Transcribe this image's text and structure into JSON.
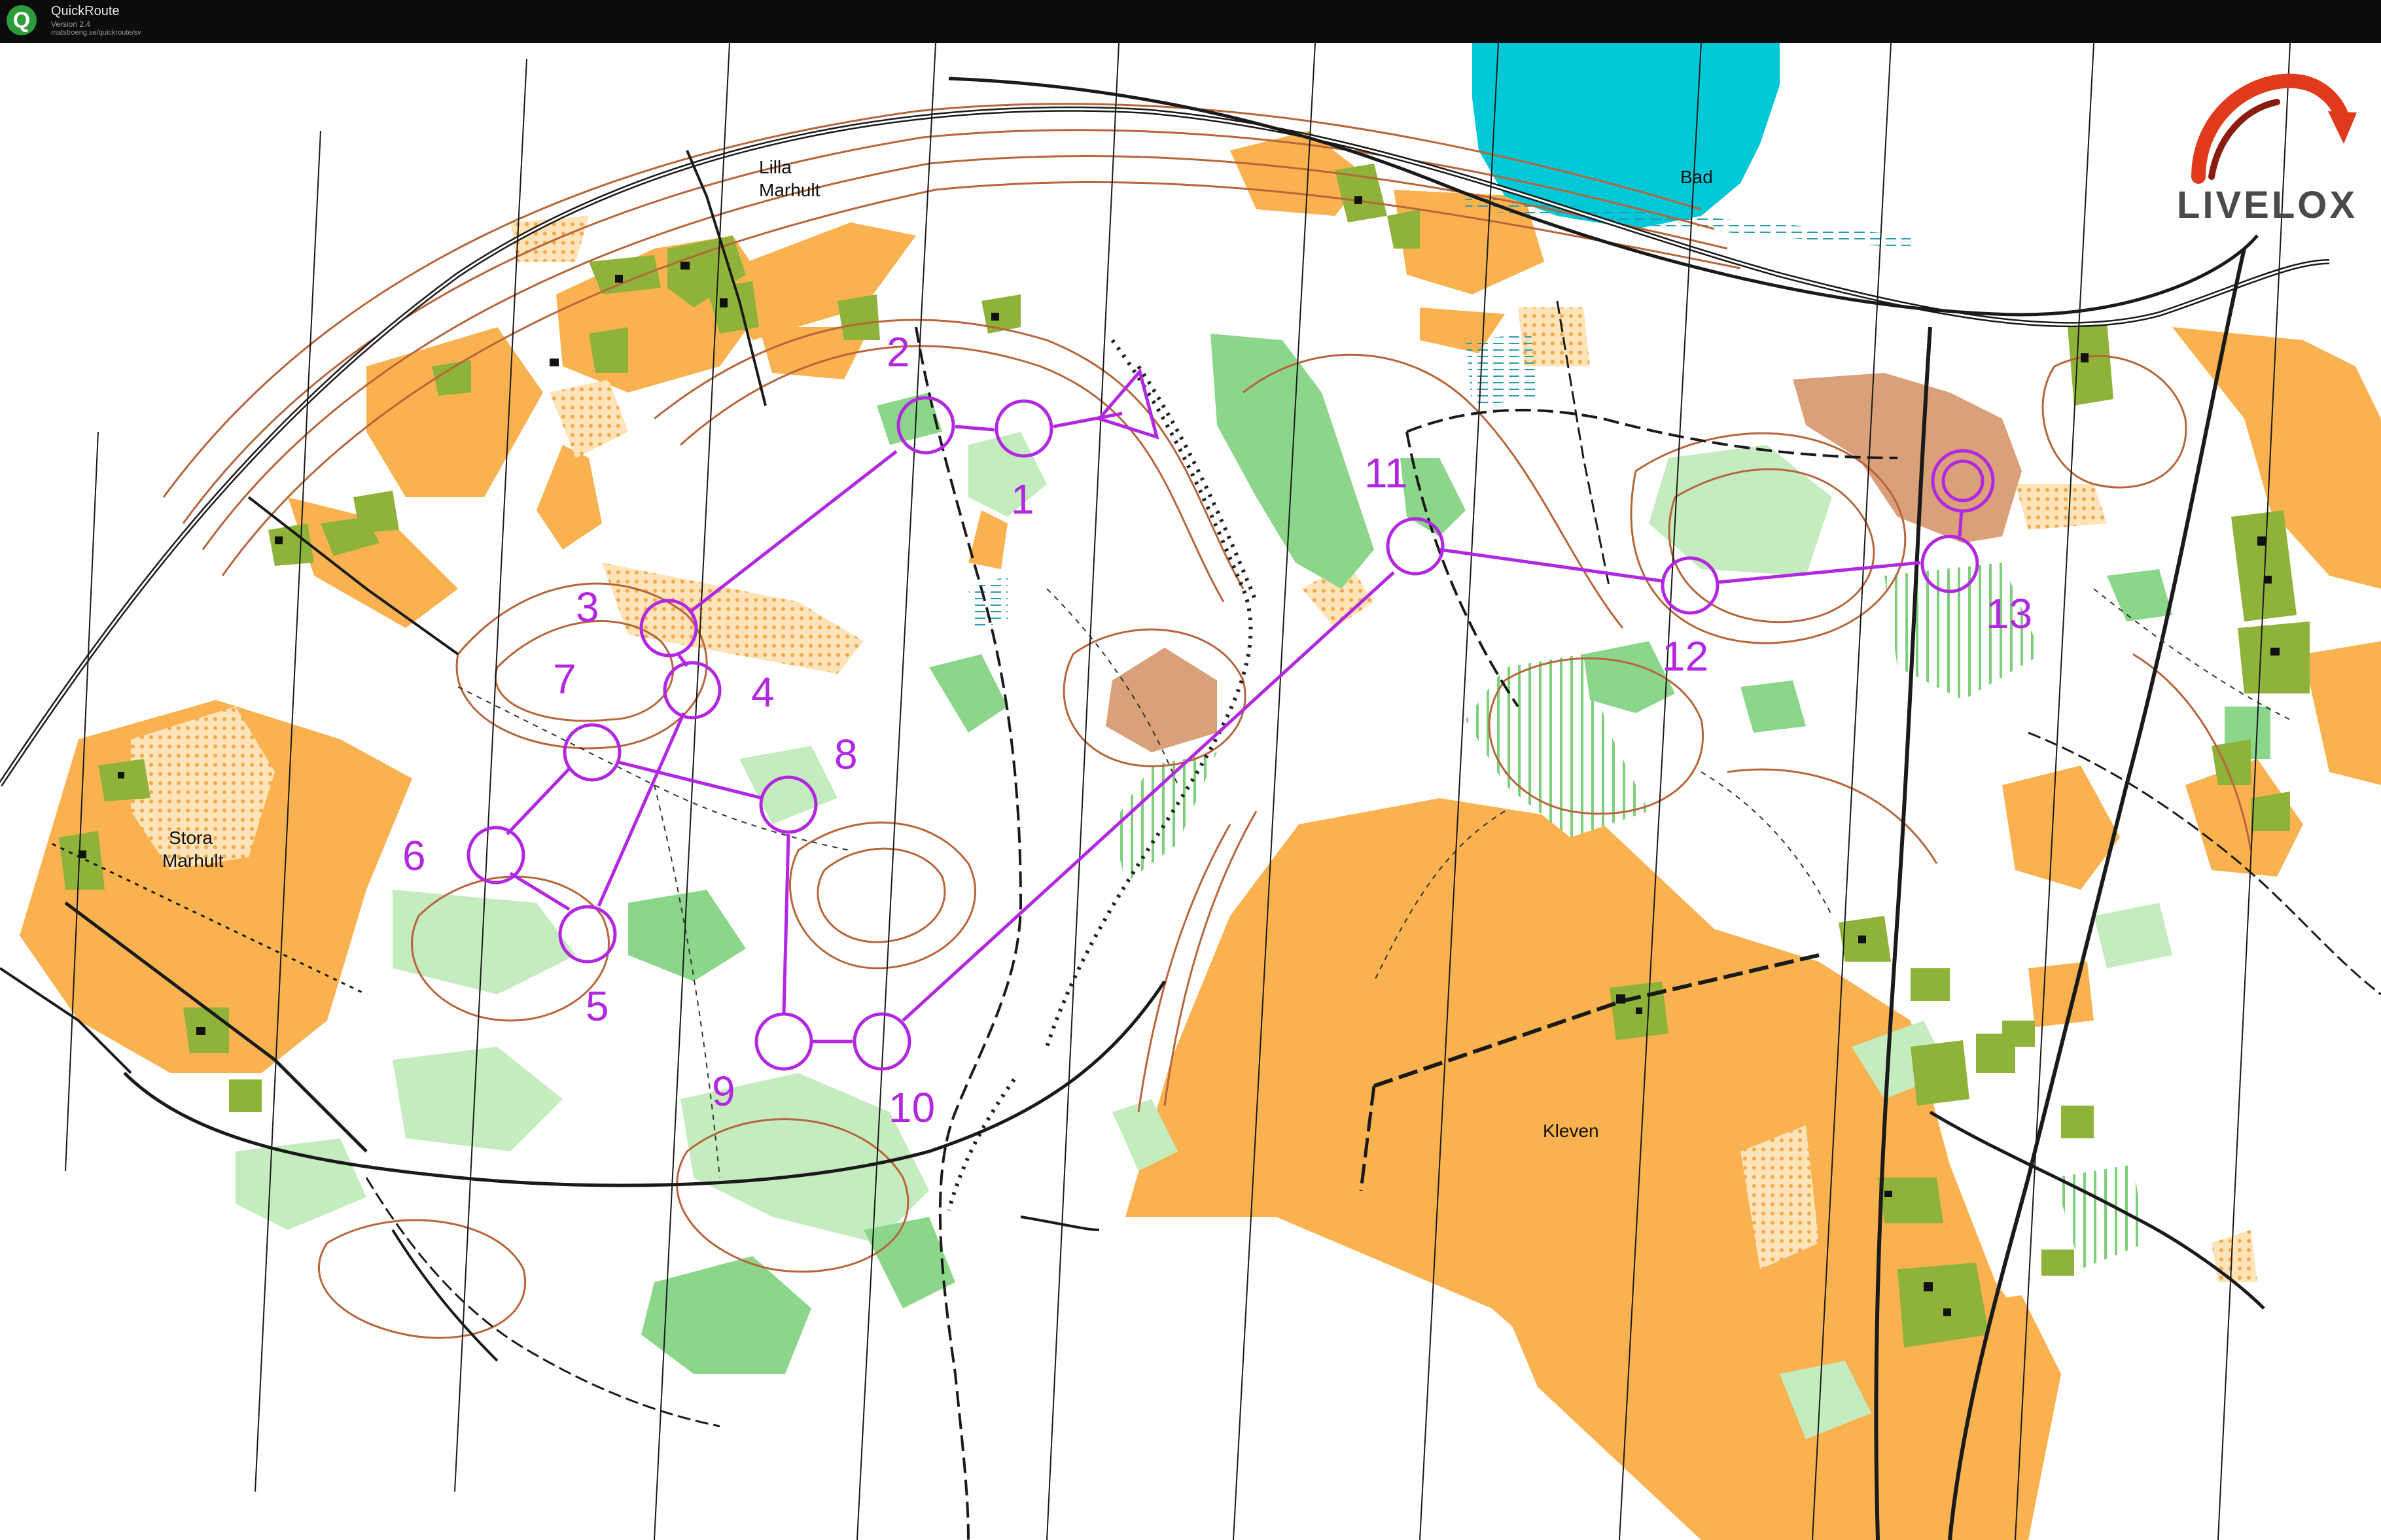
{
  "window": {
    "title": "QuickRoute",
    "version": "Version 2.4",
    "url": "matstroeng.se/quickroute/sv",
    "icon": "quickroute-q-icon"
  },
  "logo": {
    "text": "LIVELOX",
    "icon": "livelox-swoosh-icon"
  },
  "place_names": {
    "lilla_marhult_1": "Lilla",
    "lilla_marhult_2": "Marhult",
    "stora_marhult_1": "Stora",
    "stora_marhult_2": "Marhult",
    "bad": "Bad",
    "kleven": "Kleven"
  },
  "course": {
    "color": "#b227e0",
    "start_symbol": "start-triangle",
    "finish_symbol": "finish-double-circle",
    "controls": [
      {
        "number": "1",
        "label": "1"
      },
      {
        "number": "2",
        "label": "2"
      },
      {
        "number": "3",
        "label": "3"
      },
      {
        "number": "4",
        "label": "4"
      },
      {
        "number": "5",
        "label": "5"
      },
      {
        "number": "6",
        "label": "6"
      },
      {
        "number": "7",
        "label": "7"
      },
      {
        "number": "8",
        "label": "8"
      },
      {
        "number": "9",
        "label": "9"
      },
      {
        "number": "10",
        "label": "10"
      },
      {
        "number": "11",
        "label": "11"
      },
      {
        "number": "12",
        "label": "12"
      },
      {
        "number": "13",
        "label": "13"
      }
    ]
  },
  "colors": {
    "open_land": "#f9b24f",
    "rough_open": "#fcd598",
    "forest_green": "#8bd68a",
    "light_green": "#c5ecbf",
    "settlement": "#8fb33a",
    "water": "#00c8d6",
    "contour": "#b7653a",
    "track": "#1a1a1a",
    "bare_rock": "#d9a07a"
  }
}
